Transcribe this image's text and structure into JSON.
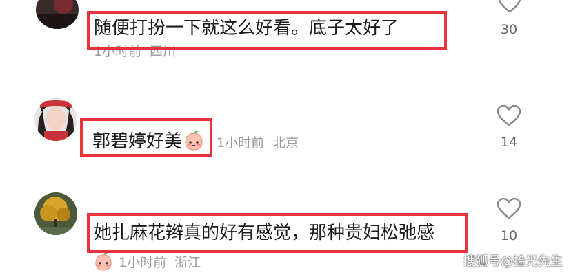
{
  "comments": [
    {
      "text": "随便打扮一下就这么好看。底子太好了",
      "time": "1小时前",
      "location": "四川",
      "likes": "30"
    },
    {
      "text": "郭碧婷好美",
      "time": "1小时前",
      "location": "北京",
      "likes": "14"
    },
    {
      "text": "她扎麻花辫真的好有感觉，那种贵妇松弛感",
      "time": "1小时前",
      "location": "浙江",
      "likes": "10"
    }
  ],
  "watermark": "搜狐号@拾光先生",
  "colors": {
    "highlight": "#e8323c",
    "meta_text": "#9a9a9a",
    "heart_stroke": "#888888"
  },
  "icons": [
    "heart-icon",
    "peach-emoji-icon"
  ]
}
